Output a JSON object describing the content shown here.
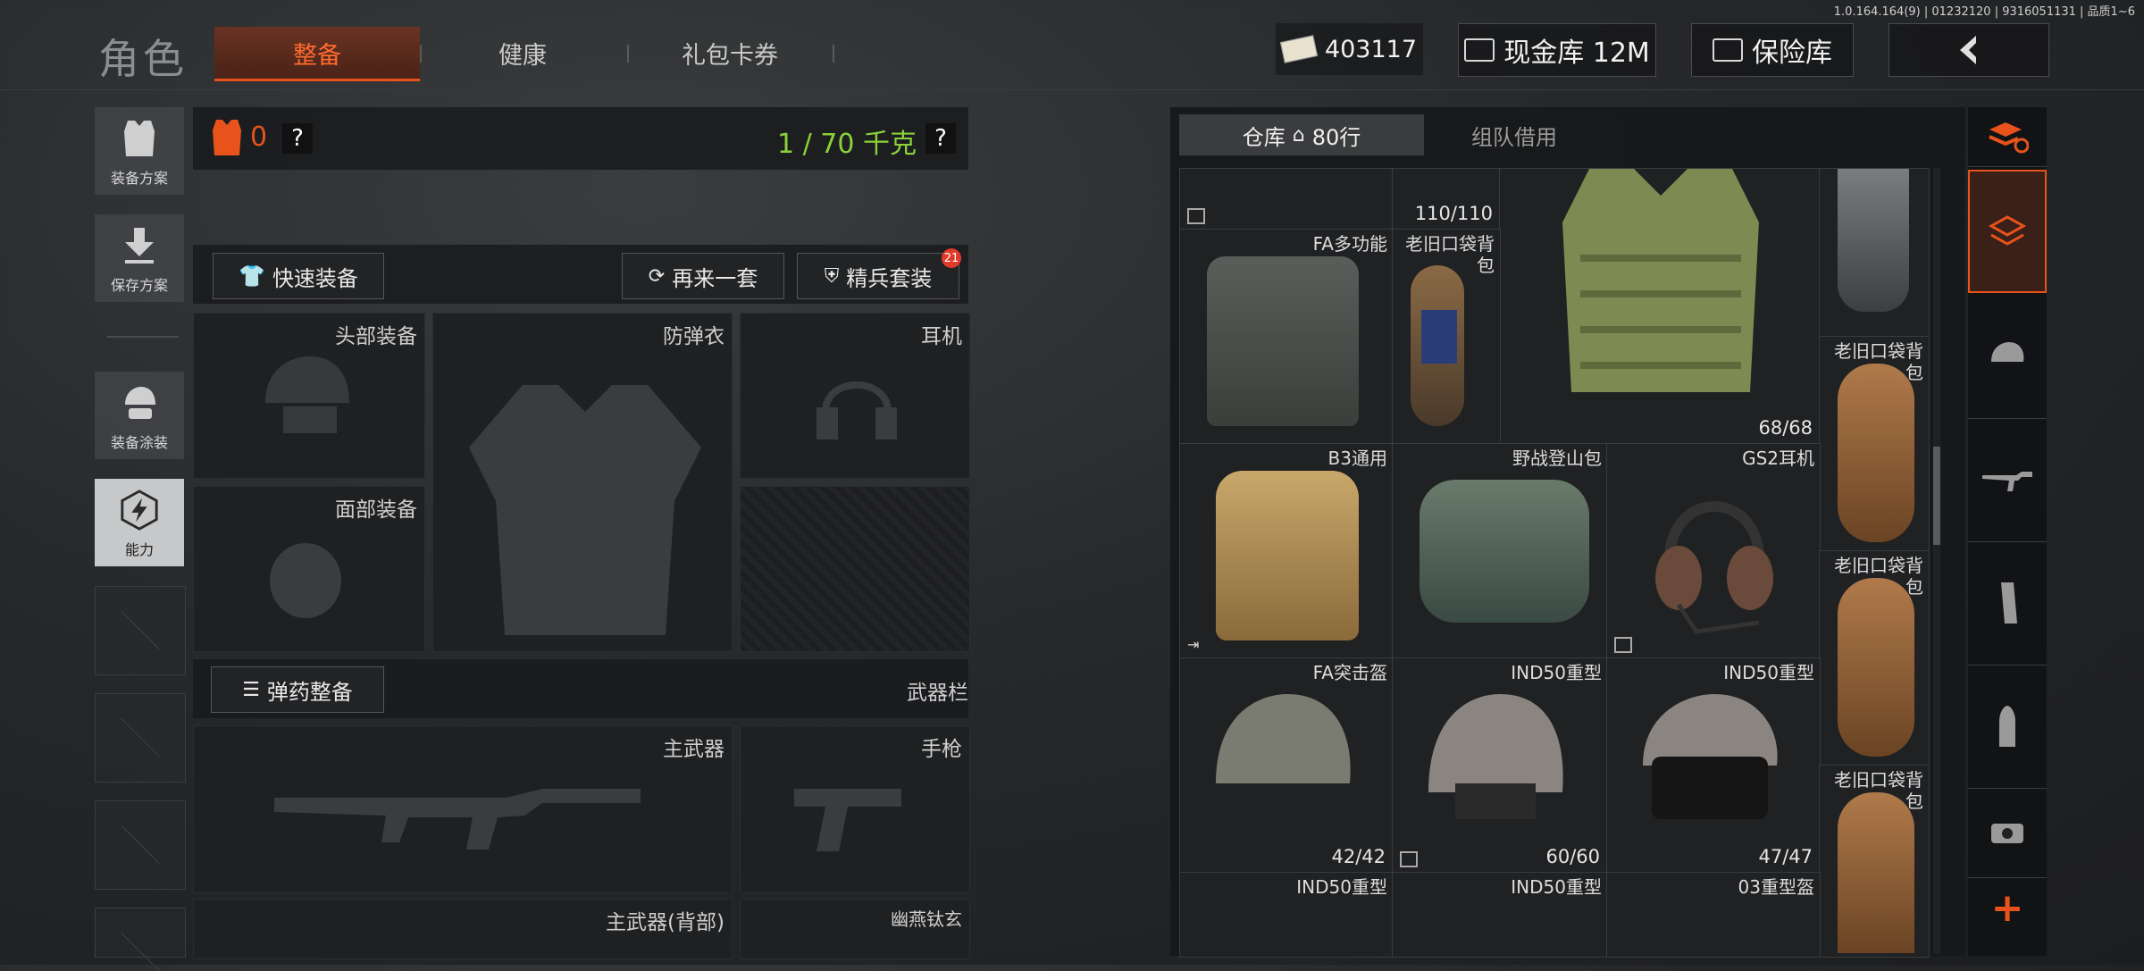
{
  "version": "1.0.164.164(9) | 01232120 | 9316051131 | 品质1~6",
  "header": {
    "title": "角色",
    "tabs": [
      {
        "label": "整备",
        "active": true
      },
      {
        "label": "健康",
        "active": false
      },
      {
        "label": "礼包卡券",
        "active": false
      }
    ],
    "currency": "403117",
    "cash_vault": "现金库 12M",
    "insurance": "保险库"
  },
  "rail": {
    "plan": "装备方案",
    "save": "保存方案",
    "paint": "装备涂装",
    "ability": "能力"
  },
  "loadout": {
    "armor_value": "0",
    "help": "?",
    "weight": "1 / 70 千克",
    "quick_equip": "快速装备",
    "reroll": "再来一套",
    "elite_set": "精兵套装",
    "elite_badge": "21",
    "slots": {
      "head": "头部装备",
      "vest": "防弹衣",
      "earphone": "耳机",
      "face": "面部装备",
      "primary": "主武器",
      "pistol": "手枪",
      "primary_back": "主武器(背部)",
      "special": "幽燕钛玄"
    },
    "ammo": "弹药整备",
    "weapon_bar": "武器栏"
  },
  "inventory": {
    "tab_storage": "仓库",
    "tab_rows": "80行",
    "tab_team": "组队借用",
    "items": {
      "top_count": "110/110",
      "fa_multi": "FA多功能",
      "old_bag": "老旧口袋背包",
      "vest_count": "68/68",
      "b3": "B3通用",
      "field_bag": "野战登山包",
      "gs2": "GS2耳机",
      "old_bag_2": "老旧口袋背包",
      "old_bag_3": "老旧口袋背包",
      "fa_helmet": "FA突击盔",
      "fa_helmet_count": "42/42",
      "ind50_a": "IND50重型",
      "ind50_a_count": "60/60",
      "ind50_b": "IND50重型",
      "ind50_b_count": "47/47",
      "ind50_c": "IND50重型",
      "ind50_d": "IND50重型",
      "h03": "03重型盔"
    }
  },
  "colors": {
    "accent": "#e8531c",
    "weight_green": "#8bd23a"
  }
}
